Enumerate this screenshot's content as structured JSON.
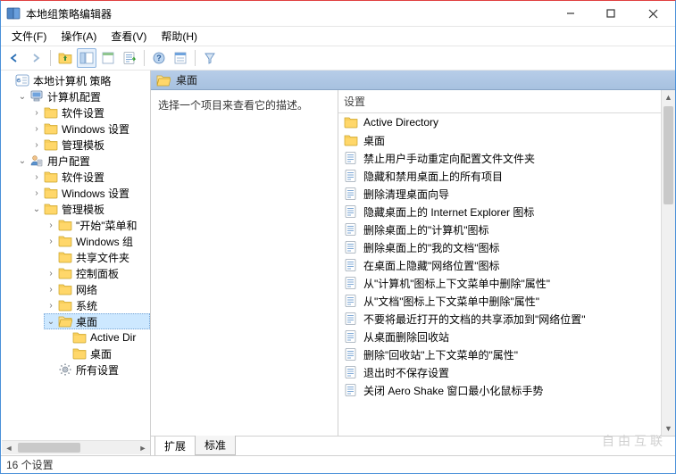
{
  "window": {
    "title": "本地组策略编辑器"
  },
  "menu": {
    "file": "文件(F)",
    "action": "操作(A)",
    "view": "查看(V)",
    "help": "帮助(H)"
  },
  "tree": {
    "root": "本地计算机 策略",
    "computer": "计算机配置",
    "c_soft": "软件设置",
    "c_win": "Windows 设置",
    "c_adm": "管理模板",
    "user": "用户配置",
    "u_soft": "软件设置",
    "u_win": "Windows 设置",
    "u_adm": "管理模板",
    "u_start": "\"开始\"菜单和",
    "u_wincomp": "Windows 组",
    "u_shared": "共享文件夹",
    "u_cpanel": "控制面板",
    "u_network": "网络",
    "u_system": "系统",
    "u_desktop": "桌面",
    "u_ad": "Active Dir",
    "u_desk2": "桌面",
    "u_all": "所有设置"
  },
  "header": {
    "title": "桌面"
  },
  "description": "选择一个项目来查看它的描述。",
  "columns": {
    "setting": "设置"
  },
  "items": [
    {
      "type": "folder",
      "label": "Active Directory"
    },
    {
      "type": "folder",
      "label": "桌面"
    },
    {
      "type": "policy",
      "label": "禁止用户手动重定向配置文件文件夹"
    },
    {
      "type": "policy",
      "label": "隐藏和禁用桌面上的所有项目"
    },
    {
      "type": "policy",
      "label": "删除清理桌面向导"
    },
    {
      "type": "policy",
      "label": "隐藏桌面上的 Internet Explorer 图标"
    },
    {
      "type": "policy",
      "label": "删除桌面上的\"计算机\"图标"
    },
    {
      "type": "policy",
      "label": "删除桌面上的\"我的文档\"图标"
    },
    {
      "type": "policy",
      "label": "在桌面上隐藏\"网络位置\"图标"
    },
    {
      "type": "policy",
      "label": "从\"计算机\"图标上下文菜单中删除\"属性\""
    },
    {
      "type": "policy",
      "label": "从\"文档\"图标上下文菜单中删除\"属性\""
    },
    {
      "type": "policy",
      "label": "不要将最近打开的文档的共享添加到\"网络位置\""
    },
    {
      "type": "policy",
      "label": "从桌面删除回收站"
    },
    {
      "type": "policy",
      "label": "删除\"回收站\"上下文菜单的\"属性\""
    },
    {
      "type": "policy",
      "label": "退出时不保存设置"
    },
    {
      "type": "policy",
      "label": "关闭 Aero Shake 窗口最小化鼠标手势"
    }
  ],
  "tabs": {
    "extended": "扩展",
    "standard": "标准"
  },
  "status": "16 个设置",
  "watermark": "自由互联"
}
